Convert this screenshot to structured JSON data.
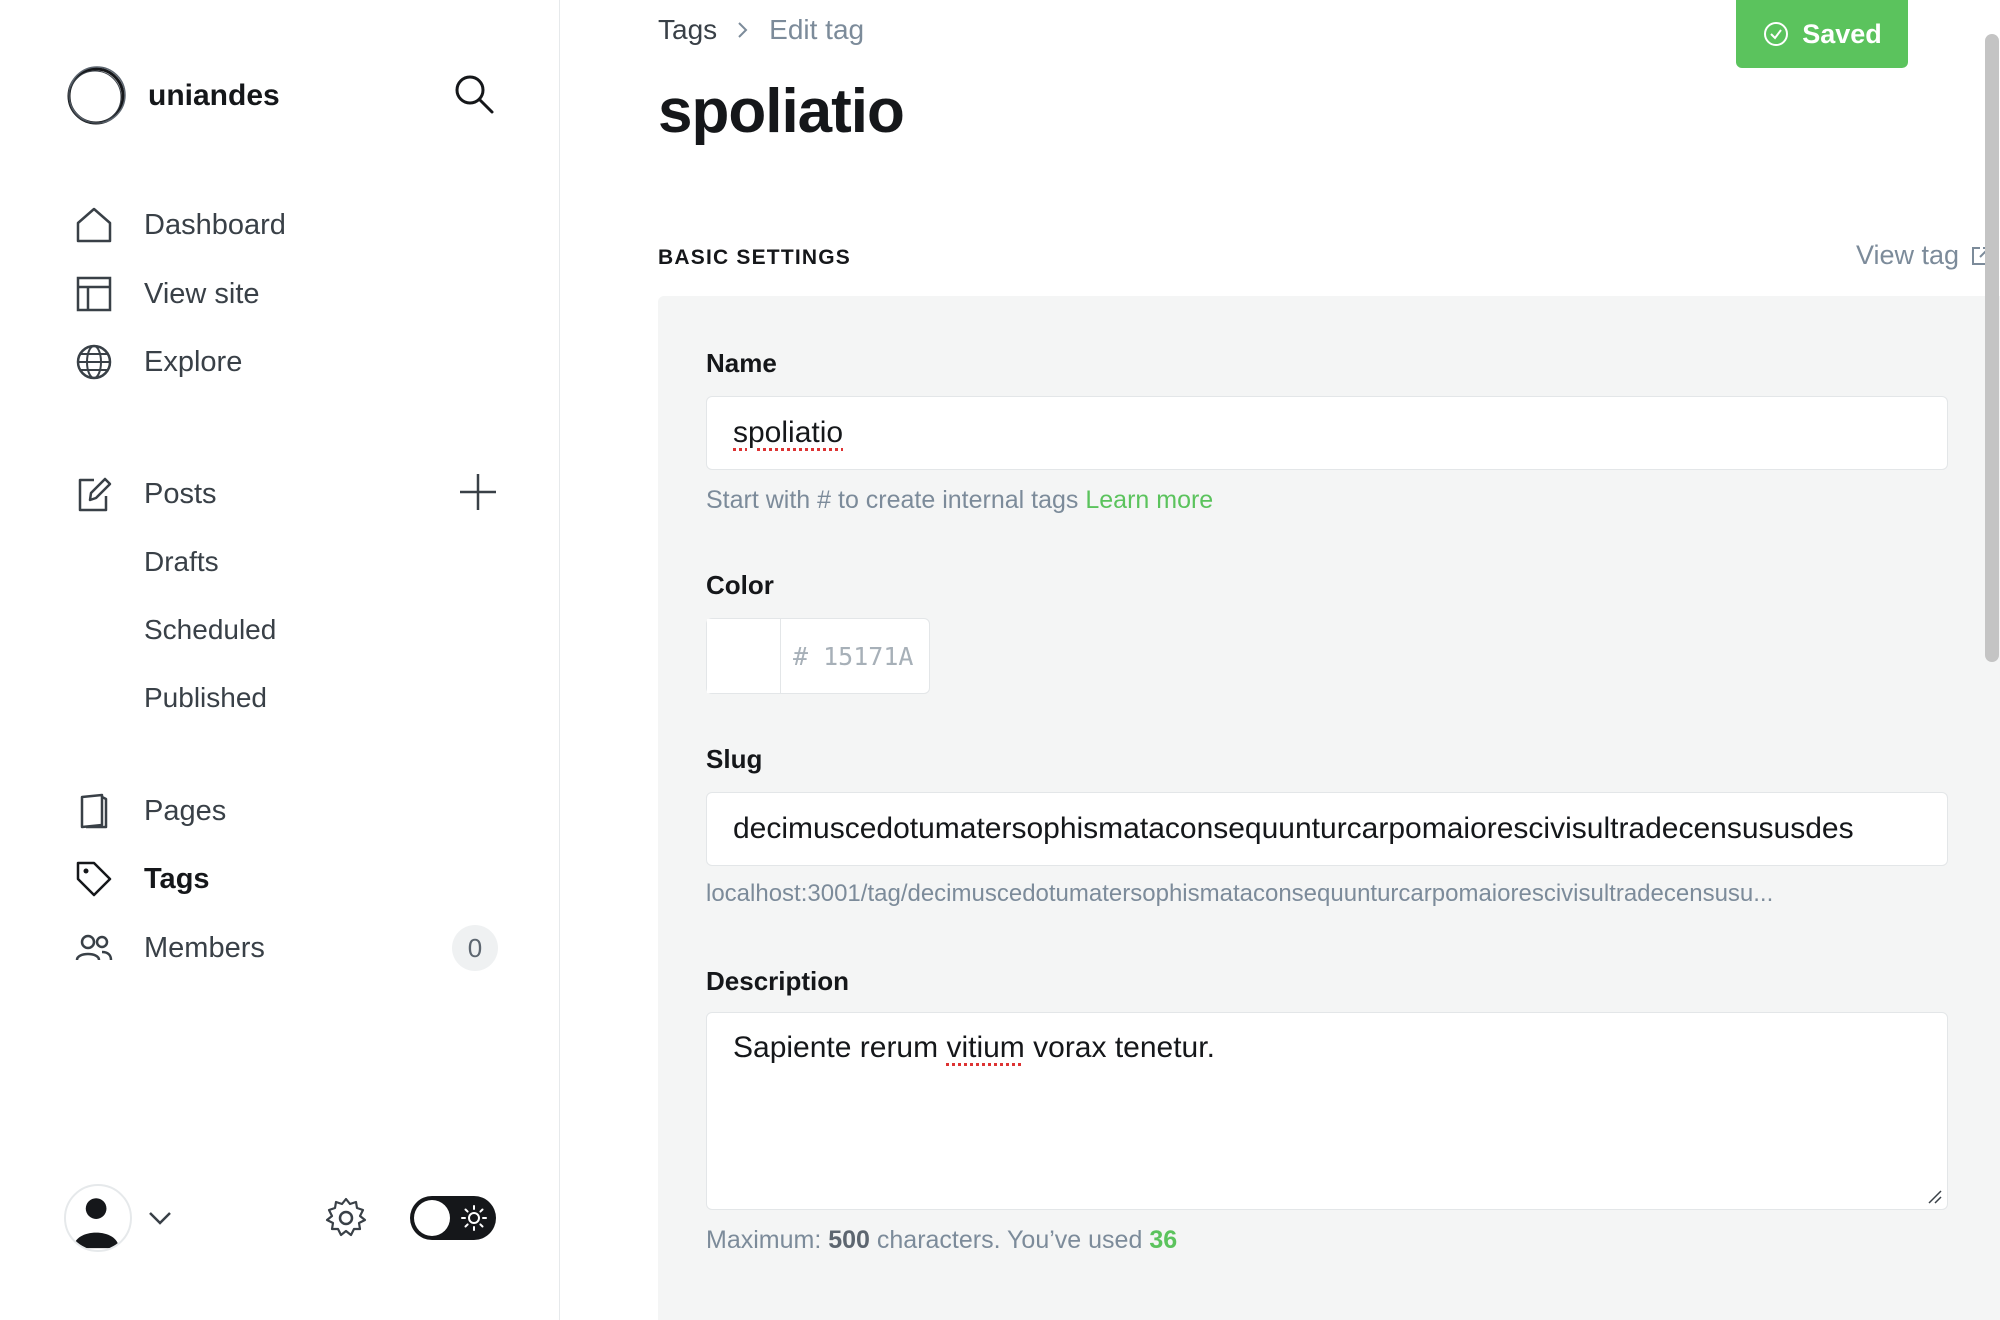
{
  "brand": {
    "name": "uniandes",
    "logo_icon": "circle-logo-icon"
  },
  "sidebar": {
    "search_icon": "search-icon",
    "items": [
      {
        "label": "Dashboard",
        "icon": "home-icon"
      },
      {
        "label": "View site",
        "icon": "layout-icon"
      },
      {
        "label": "Explore",
        "icon": "globe-icon"
      },
      {
        "label": "Posts",
        "icon": "edit-icon"
      },
      {
        "label": "Drafts"
      },
      {
        "label": "Scheduled"
      },
      {
        "label": "Published"
      },
      {
        "label": "Pages",
        "icon": "page-icon"
      },
      {
        "label": "Tags",
        "icon": "tag-icon",
        "active": true
      },
      {
        "label": "Members",
        "icon": "members-icon",
        "count": "0"
      }
    ]
  },
  "header": {
    "breadcrumb_root": "Tags",
    "breadcrumb_current": "Edit tag",
    "saved_label": "Saved",
    "title": "spoliatio"
  },
  "settings": {
    "section_title": "BASIC SETTINGS",
    "view_tag_label": "View tag",
    "name": {
      "label": "Name",
      "value": "spoliatio",
      "hint_text": "Start with # to create internal tags ",
      "hint_link": "Learn more"
    },
    "color": {
      "label": "Color",
      "hash": "#",
      "placeholder": "15171A",
      "swatch_hex": "#ffffff"
    },
    "slug": {
      "label": "Slug",
      "value": "decimuscedotumatersophismataconsequunturcarpomaiorescivisultradecensususdes",
      "url": "localhost:3001/tag/decimuscedotumatersophismataconsequunturcarpomaiorescivisultradecensusu..."
    },
    "description": {
      "label": "Description",
      "value_before": "Sapiente rerum ",
      "value_misspelled": "vitium",
      "value_after": " vorax tenetur.",
      "counter_prefix": "Maximum: ",
      "counter_max": "500",
      "counter_middle": " characters. You’ve used ",
      "counter_used": "36"
    }
  },
  "colors": {
    "accent_green": "#5bc35d",
    "text_dark": "#15171a",
    "muted": "#7c8b9a"
  }
}
